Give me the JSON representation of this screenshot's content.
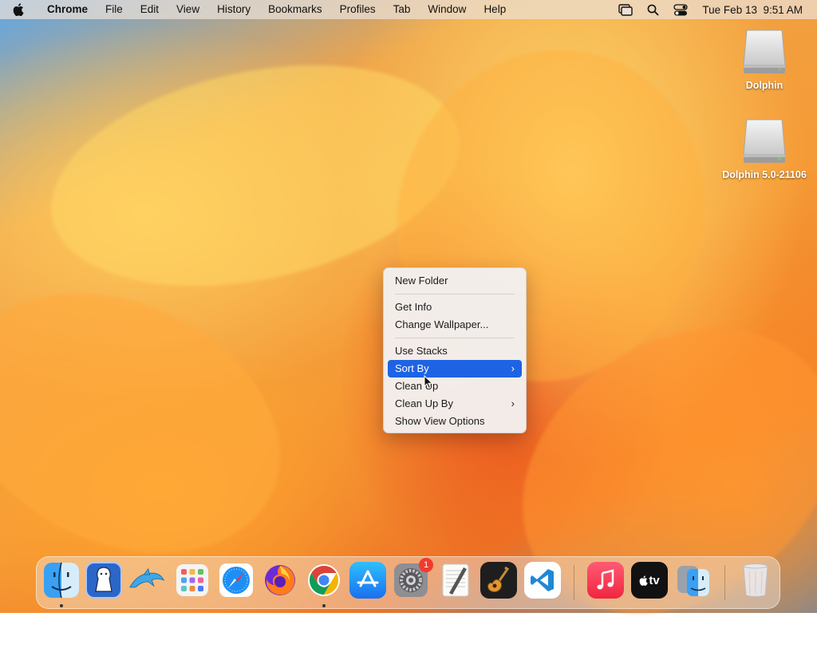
{
  "menubar": {
    "app_name": "Chrome",
    "items": [
      "File",
      "Edit",
      "View",
      "History",
      "Bookmarks",
      "Profiles",
      "Tab",
      "Window",
      "Help"
    ],
    "clock": "Tue Feb 13  9:51 AM"
  },
  "desktop_icons": [
    {
      "label": "Dolphin",
      "icon": "external-drive-icon"
    },
    {
      "label": "Dolphin 5.0-21106",
      "icon": "external-drive-icon"
    }
  ],
  "context_menu": {
    "items": {
      "new_folder": "New Folder",
      "get_info": "Get Info",
      "change_wallpaper": "Change Wallpaper...",
      "use_stacks": "Use Stacks",
      "sort_by": "Sort By",
      "clean_up": "Clean Up",
      "clean_up_by": "Clean Up By",
      "show_view_options": "Show View Options"
    },
    "highlighted": "Sort By",
    "accent_color": "#1e63e4"
  },
  "dock": {
    "apps": [
      {
        "name": "Finder",
        "icon": "finder-icon",
        "running": true
      },
      {
        "name": "Ryujinx",
        "icon": "ryujinx-icon",
        "running": false
      },
      {
        "name": "Dolphin",
        "icon": "dolphin-icon",
        "running": false
      },
      {
        "name": "Launchpad",
        "icon": "launchpad-icon",
        "running": false
      },
      {
        "name": "Safari",
        "icon": "safari-icon",
        "running": false
      },
      {
        "name": "Firefox",
        "icon": "firefox-icon",
        "running": false
      },
      {
        "name": "Chrome",
        "icon": "chrome-icon",
        "running": true
      },
      {
        "name": "App Store",
        "icon": "app-store-icon",
        "running": false
      },
      {
        "name": "System Settings",
        "icon": "system-settings-icon",
        "running": false,
        "badge": "1"
      },
      {
        "name": "TextEdit",
        "icon": "textedit-icon",
        "running": false
      },
      {
        "name": "GarageBand",
        "icon": "garageband-icon",
        "running": false
      },
      {
        "name": "Visual Studio Code",
        "icon": "vscode-icon",
        "running": false
      },
      {
        "name": "Music",
        "icon": "music-icon",
        "running": false
      },
      {
        "name": "TV",
        "icon": "apple-tv-icon",
        "running": false
      },
      {
        "name": "Migration Assistant",
        "icon": "migration-assistant-icon",
        "running": false
      },
      {
        "name": "Trash",
        "icon": "trash-icon",
        "running": false
      }
    ],
    "tv_label": "tv"
  }
}
